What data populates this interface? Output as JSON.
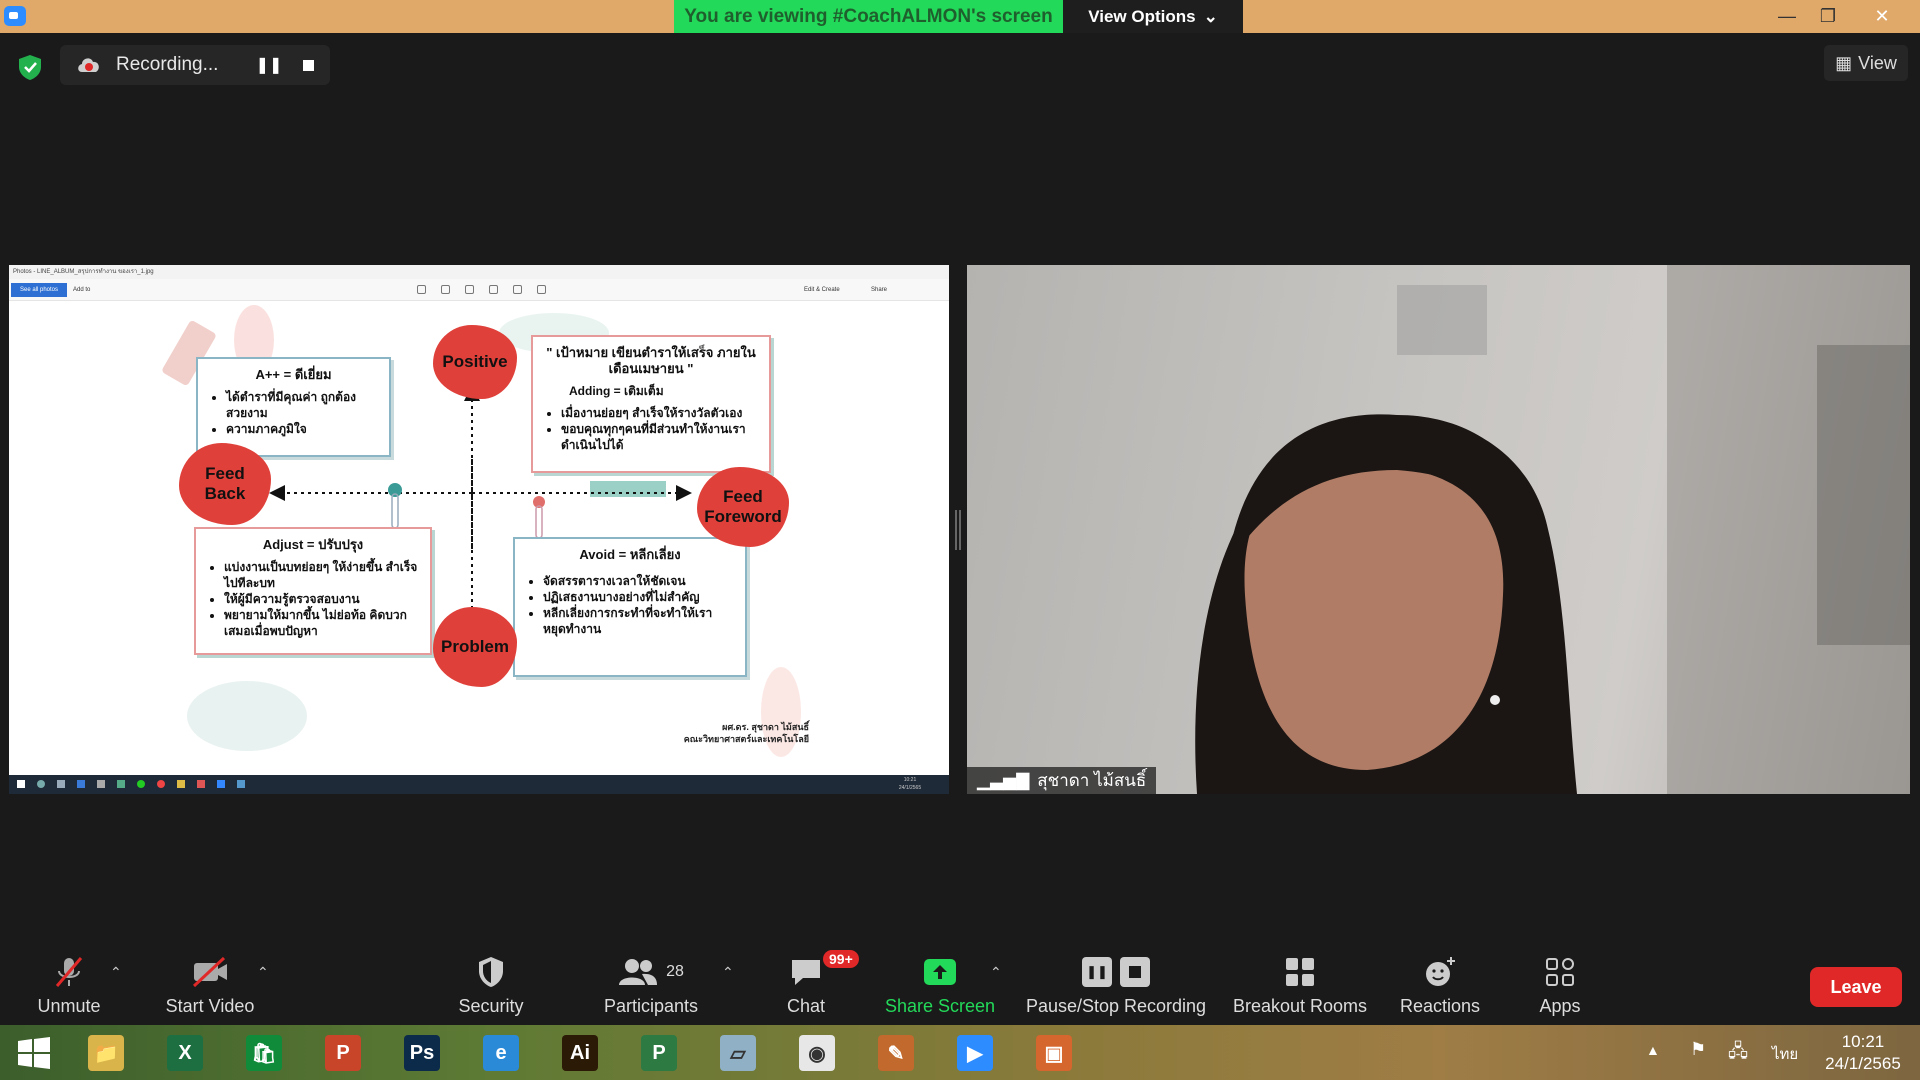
{
  "titlebar": {
    "viewing_banner": "You are viewing #CoachALMON's screen",
    "view_options": "View Options"
  },
  "recording": {
    "label": "Recording..."
  },
  "view_button": "View",
  "shared_screen": {
    "photos_title": "Photos - LINE_ALBUM_สรุปการทำงาน ของเรา_1.jpg",
    "see_all_photos": "See all photos",
    "add_to": "Add to",
    "edit_create": "Edit & Create",
    "share": "Share",
    "taskbar_time": "10:21",
    "taskbar_date": "24/1/2565",
    "slide": {
      "box_a": {
        "title": "A++ = ดีเยี่ยม",
        "items": [
          "ได้ตำราที่มีคุณค่า ถูกต้อง สวยงาม",
          "ความภาคภูมิใจ"
        ]
      },
      "box_goal": {
        "title": "\" เป้าหมาย เขียนตำราให้เสร็จ ภายในเดือนเมษายน \"",
        "subtitle": "Adding = เติมเต็ม",
        "items": [
          "เมื่องานย่อยๆ สำเร็จให้รางวัลตัวเอง",
          "ขอบคุณทุกๆคนที่มีส่วนทำให้งานเราดำเนินไปได้"
        ]
      },
      "box_adjust": {
        "title": "Adjust = ปรับปรุง",
        "items": [
          "แบ่งงานเป็นบทย่อยๆ ให้ง่ายขึ้น สำเร็จไปทีละบท",
          "ให้ผู้มีความรู้ตรวจสอบงาน",
          "พยายามให้มากขึ้น ไม่ย่อท้อ คิดบวกเสมอเมื่อพบปัญหา"
        ]
      },
      "box_avoid": {
        "title": "Avoid = หลีกเลี่ยง",
        "items": [
          "จัดสรรตารางเวลาให้ชัดเจน",
          "ปฏิเสธงานบางอย่างที่ไม่สำคัญ",
          "หลีกเลี่ยงการกระทำที่จะทำให้เราหยุดทำงาน"
        ]
      },
      "blob_positive": "Positive",
      "blob_feedback": "Feed\nBack",
      "blob_feedforeword": "Feed\nForeword",
      "blob_problem": "Problem",
      "author_line1": "ผศ.ดร. สุชาดา ไม้สนธิ์",
      "author_line2": "คณะวิทยาศาสตร์และเทคโนโลยี"
    }
  },
  "camera": {
    "participant_name": "สุชาดา ไม้สนธิ์"
  },
  "toolbar": {
    "unmute": "Unmute",
    "start_video": "Start Video",
    "security": "Security",
    "participants": "Participants",
    "participants_count": "28",
    "chat": "Chat",
    "chat_badge": "99+",
    "share_screen": "Share Screen",
    "pause_stop_recording": "Pause/Stop Recording",
    "breakout_rooms": "Breakout Rooms",
    "reactions": "Reactions",
    "apps": "Apps",
    "leave": "Leave"
  },
  "windows_taskbar": {
    "apps": [
      {
        "name": "file-explorer",
        "color": "#d9b44a",
        "glyph": "📁"
      },
      {
        "name": "excel",
        "color": "#1d6f42",
        "glyph": "X"
      },
      {
        "name": "store",
        "color": "#0f8b3a",
        "glyph": "🛍"
      },
      {
        "name": "powerpoint",
        "color": "#c9452a",
        "glyph": "P"
      },
      {
        "name": "photoshop",
        "color": "#0c2a4a",
        "glyph": "Ps"
      },
      {
        "name": "internet-explorer",
        "color": "#2b8ad8",
        "glyph": "e"
      },
      {
        "name": "illustrator",
        "color": "#2b1a05",
        "glyph": "Ai"
      },
      {
        "name": "project",
        "color": "#2d7a43",
        "glyph": "P"
      },
      {
        "name": "notes",
        "color": "#8fb0c5",
        "glyph": "▱"
      },
      {
        "name": "chrome",
        "color": "#e7e7e7",
        "glyph": "◉"
      },
      {
        "name": "paint",
        "color": "#c26a2e",
        "glyph": "✎"
      },
      {
        "name": "zoom",
        "color": "#2d8cff",
        "glyph": "▶"
      },
      {
        "name": "powerpoint-slide",
        "color": "#d4662e",
        "glyph": "▣"
      }
    ],
    "language": "ไทย",
    "time": "10:21",
    "date": "24/1/2565"
  }
}
